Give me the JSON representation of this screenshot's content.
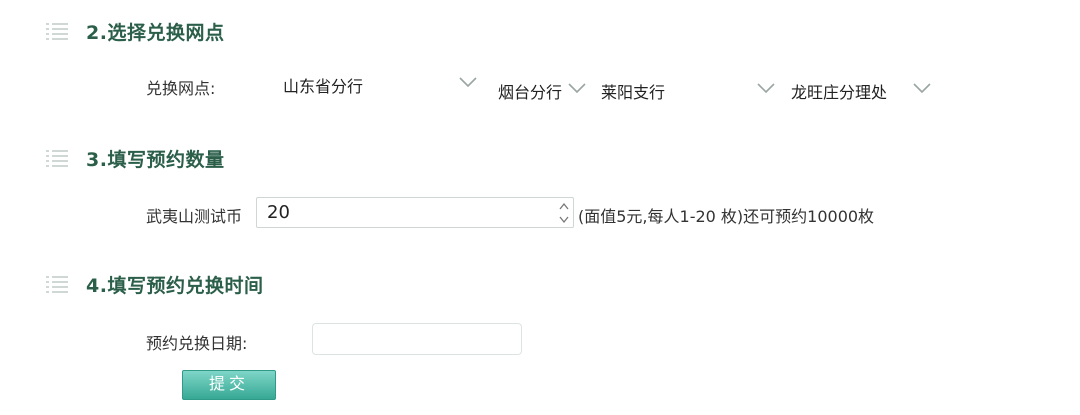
{
  "sections": {
    "branch": {
      "title": "2.选择兑换网点",
      "label": "兑换网点:",
      "selects": [
        {
          "value": "山东省分行"
        },
        {
          "value": "烟台分行"
        },
        {
          "value": "莱阳支行"
        },
        {
          "value": "龙旺庄分理处"
        }
      ]
    },
    "quantity": {
      "title": "3.填写预约数量",
      "coin_label": "武夷山测试币",
      "value": "20",
      "hint": "(面值5元,每人1-20 枚)还可预约10000枚"
    },
    "time": {
      "title": "4.填写预约兑换时间",
      "date_label": "预约兑换日期:",
      "date_value": ""
    }
  },
  "submit_label": "提交",
  "colors": {
    "section_title": "#2b5f4a",
    "icon": "#cfd8d5",
    "button": "#48b6a3"
  },
  "icons": [
    "list-icon",
    "chevron-down-icon",
    "spinner-icon"
  ]
}
